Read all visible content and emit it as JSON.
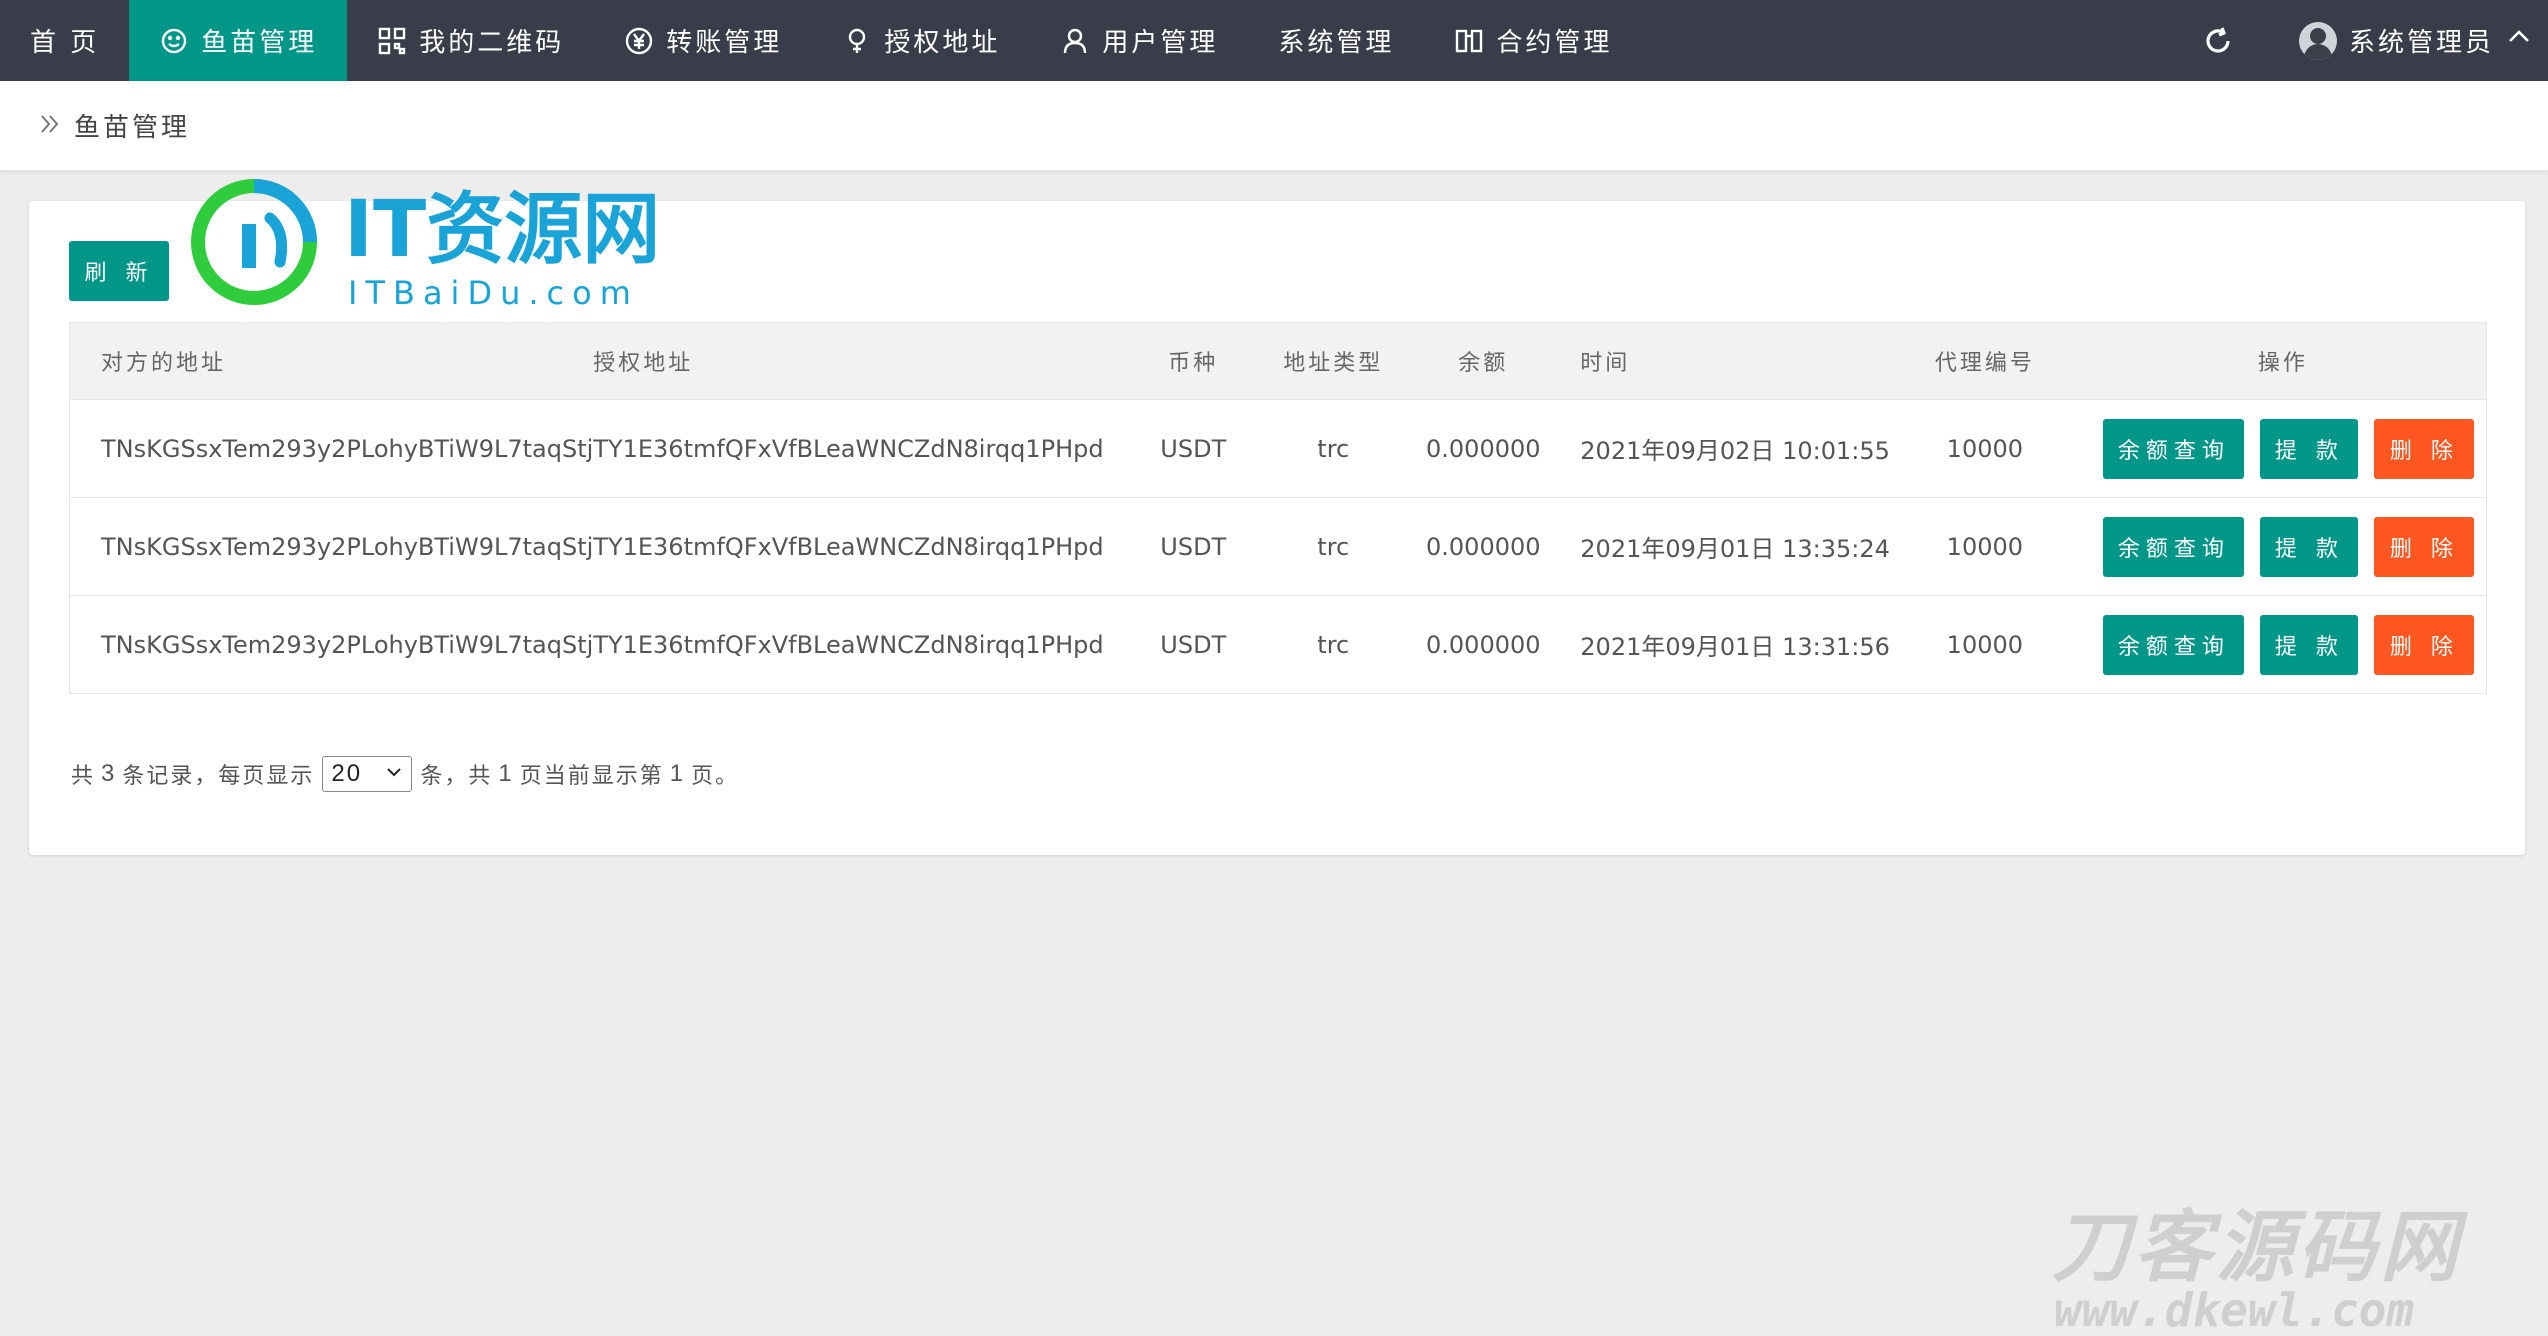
{
  "nav": {
    "items": [
      {
        "label": "首 页",
        "icon": "home"
      },
      {
        "label": "鱼苗管理",
        "icon": "smile-icon",
        "active": true
      },
      {
        "label": "我的二维码",
        "icon": "qrcode-icon"
      },
      {
        "label": "转账管理",
        "icon": "yen-icon"
      },
      {
        "label": "授权地址",
        "icon": "location-icon"
      },
      {
        "label": "用户管理",
        "icon": "user-icon"
      },
      {
        "label": "系统管理",
        "icon": ""
      },
      {
        "label": "合约管理",
        "icon": "contract-icon"
      }
    ],
    "user": "系统管理员"
  },
  "breadcrumb": {
    "current": "鱼苗管理"
  },
  "toolbar": {
    "refresh_label": "刷 新"
  },
  "table": {
    "headers": [
      "对方的地址",
      "授权地址",
      "币种",
      "地址类型",
      "余额",
      "时间",
      "代理编号",
      "操作"
    ],
    "rows": [
      {
        "other": "TNsKGSsxTem293y2PLohyBTiW9L7taqStj",
        "auth": "TY1E36tmfQFxVfBLeaWNCZdN8irqq1PHpd",
        "coin": "USDT",
        "type": "trc",
        "balance": "0.000000",
        "time": "2021年09月02日 10:01:55",
        "agent": "10000"
      },
      {
        "other": "TNsKGSsxTem293y2PLohyBTiW9L7taqStj",
        "auth": "TY1E36tmfQFxVfBLeaWNCZdN8irqq1PHpd",
        "coin": "USDT",
        "type": "trc",
        "balance": "0.000000",
        "time": "2021年09月01日 13:35:24",
        "agent": "10000"
      },
      {
        "other": "TNsKGSsxTem293y2PLohyBTiW9L7taqStj",
        "auth": "TY1E36tmfQFxVfBLeaWNCZdN8irqq1PHpd",
        "coin": "USDT",
        "type": "trc",
        "balance": "0.000000",
        "time": "2021年09月01日 13:31:56",
        "agent": "10000"
      }
    ],
    "actions": {
      "balance": "余额查询",
      "withdraw": "提 款",
      "delete": "删 除"
    }
  },
  "pager": {
    "t1": "共",
    "total": "3",
    "t2": "条记录，每页显示",
    "per_page": "20",
    "t3": "条，共",
    "pages": "1",
    "t4": "页当前显示第",
    "current": "1",
    "t5": "页。"
  },
  "watermarks": {
    "it_main": "IT资源网",
    "it_sub": "ITBaiDu.com",
    "dk_main": "刀客源码网",
    "dk_sub": "www.dkewl.com"
  },
  "colors": {
    "nav_bg": "#393d49",
    "accent": "#009688",
    "danger": "#ff5722"
  }
}
